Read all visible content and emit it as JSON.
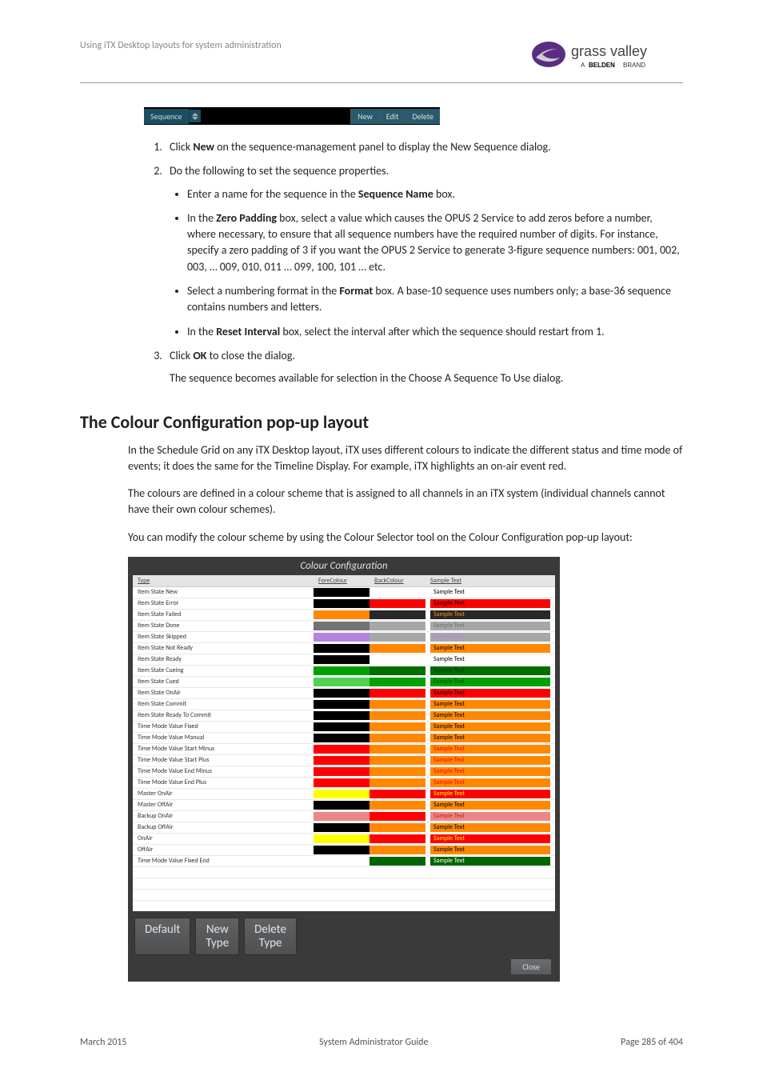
{
  "header": {
    "text": "Using iTX Desktop layouts for system administration",
    "brand_main": "grass valley",
    "brand_sub": "A BELDEN BRAND"
  },
  "sequence_bar": {
    "label": "Sequence",
    "btn_new": "New",
    "btn_edit": "Edit",
    "btn_delete": "Delete"
  },
  "steps": {
    "s1_pre": "Click ",
    "s1_bold": "New",
    "s1_post": " on the sequence-management panel to display the New Sequence dialog.",
    "s2": "Do the following to set the sequence properties.",
    "s2_b1_pre": "Enter a name for the sequence in the ",
    "s2_b1_bold": "Sequence Name",
    "s2_b1_post": " box.",
    "s2_b2_pre": "In the ",
    "s2_b2_bold": "Zero Padding",
    "s2_b2_post": " box, select a value which causes the OPUS 2 Service to add zeros before a number, where necessary, to ensure that all sequence numbers have the required number of digits. For instance, specify a zero padding of 3 if you want the OPUS 2 Service to generate 3-figure sequence numbers: 001, 002, 003, … 009, 010, 011 … 099, 100, 101 … etc.",
    "s2_b3_pre": "Select a numbering format in the ",
    "s2_b3_bold": "Format",
    "s2_b3_post": " box. A base-10 sequence uses numbers only; a base-36 sequence contains numbers and letters.",
    "s2_b4_pre": "In the ",
    "s2_b4_bold": "Reset Interval",
    "s2_b4_post": " box, select the interval after which the sequence should restart from 1.",
    "s3_pre": "Click ",
    "s3_bold": "OK",
    "s3_post": " to close the dialog.",
    "s3_after": "The sequence becomes available for selection in the Choose A Sequence To Use dialog."
  },
  "section_title": "The Colour Configuration pop-up layout",
  "paras": {
    "p1": "In the Schedule Grid on any iTX Desktop layout, iTX uses different colours to indicate the different status and time mode of events; it does the same for the Timeline Display. For example, iTX highlights an on-air event red.",
    "p2": "The colours are defined in a colour scheme that is assigned to all channels in an iTX system (individual channels cannot have their own colour schemes).",
    "p3": "You can modify the colour scheme by using the Colour Selector tool on the Colour Configuration pop-up layout:"
  },
  "cc": {
    "title": "Colour Configuration",
    "col_type": "Type",
    "col_front": "ForeColour",
    "col_back": "BackColour",
    "col_sample": "Sample Text",
    "rows": [
      {
        "type": "Item State New",
        "front": "#000000",
        "back": "#ffffff",
        "sample": "Sample Text",
        "sf": "#000000",
        "sb": "#ffffff"
      },
      {
        "type": "Item State Error",
        "front": "#000000",
        "back": "#ff0000",
        "sample": "Sample Text",
        "sf": "#000000",
        "sb": "#ff0000"
      },
      {
        "type": "Item State Failed",
        "front": "#ff8800",
        "back": "#282828",
        "sample": "Sample Text",
        "sf": "#ff8800",
        "sb": "#282828"
      },
      {
        "type": "Item State Done",
        "front": "#737373",
        "back": "#a7a7a7",
        "sample": "Sample Text",
        "sf": "#737373",
        "sb": "#a7a7a7"
      },
      {
        "type": "Item State Skipped",
        "front": "#b684de",
        "back": "#a7a7a7",
        "sample": "Sample Text",
        "sf": "#b684de",
        "sb": "#a7a7a7"
      },
      {
        "type": "Item State Not Ready",
        "front": "#000000",
        "back": "#ff8800",
        "sample": "Sample Text",
        "sf": "#000000",
        "sb": "#ff8800"
      },
      {
        "type": "Item State Ready",
        "front": "#000000",
        "back": "#ffffff",
        "sample": "Sample Text",
        "sf": "#000000",
        "sb": "#ffffff"
      },
      {
        "type": "Item State Cueing",
        "front": "#00a100",
        "back": "#006e00",
        "sample": "Sample Text",
        "sf": "#003800",
        "sb": "#006e00"
      },
      {
        "type": "Item State Cued",
        "front": "#52d252",
        "back": "#00a100",
        "sample": "Sample Text",
        "sf": "#0e4c0e",
        "sb": "#00a100"
      },
      {
        "type": "Item State OnAir",
        "front": "#000000",
        "back": "#ff0000",
        "sample": "Sample Text",
        "sf": "#000000",
        "sb": "#ff0000"
      },
      {
        "type": "Item State Commit",
        "front": "#000000",
        "back": "#ff8800",
        "sample": "Sample Text",
        "sf": "#000000",
        "sb": "#ff8800"
      },
      {
        "type": "Item State Ready To Commit",
        "front": "#000000",
        "back": "#ff8800",
        "sample": "Sample Text",
        "sf": "#000000",
        "sb": "#ff8800"
      },
      {
        "type": "Time Mode Value Fixed",
        "front": "#000000",
        "back": "#ff8800",
        "sample": "Sample Text",
        "sf": "#000000",
        "sb": "#ff8800"
      },
      {
        "type": "Time Mode Value Manual",
        "front": "#000000",
        "back": "#ff8800",
        "sample": "Sample Text",
        "sf": "#000000",
        "sb": "#ff8800"
      },
      {
        "type": "Time Mode Value Start Minus",
        "front": "#ff0000",
        "back": "#ff8800",
        "sample": "Sample Text",
        "sf": "#ff0000",
        "sb": "#ff8800"
      },
      {
        "type": "Time Mode Value Start Plus",
        "front": "#ff0000",
        "back": "#ff8800",
        "sample": "Sample Text",
        "sf": "#ff0000",
        "sb": "#ff8800"
      },
      {
        "type": "Time Mode Value End Minus",
        "front": "#ff0000",
        "back": "#ff8800",
        "sample": "Sample Text",
        "sf": "#ff0000",
        "sb": "#ff8800"
      },
      {
        "type": "Time Mode Value End Plus",
        "front": "#ff0000",
        "back": "#ff8800",
        "sample": "Sample Text",
        "sf": "#ff0000",
        "sb": "#ff8800"
      },
      {
        "type": "Master OnAir",
        "front": "#ffff00",
        "back": "#ff0000",
        "sample": "Sample Text",
        "sf": "#ffff00",
        "sb": "#ff0000"
      },
      {
        "type": "Master OffAir",
        "front": "#000000",
        "back": "#ff8800",
        "sample": "Sample Text",
        "sf": "#000000",
        "sb": "#ff8800"
      },
      {
        "type": "Backup OnAir",
        "front": "#ed8787",
        "back": "#ff0000",
        "sample": "Sample Text",
        "sf": "#cf1818",
        "sb": "#ed8787"
      },
      {
        "type": "Backup OffAir",
        "front": "#000000",
        "back": "#ff8800",
        "sample": "Sample Text",
        "sf": "#000000",
        "sb": "#ff8800"
      },
      {
        "type": "OnAir",
        "front": "#ffff00",
        "back": "#ff0000",
        "sample": "Sample Text",
        "sf": "#ffff00",
        "sb": "#ff0000"
      },
      {
        "type": "OffAir",
        "front": "#000000",
        "back": "#ff8800",
        "sample": "Sample Text",
        "sf": "#000000",
        "sb": "#ff8800"
      },
      {
        "type": "Time Mode Value Fixed End",
        "front": "#ffffff",
        "back": "#006400",
        "sample": "Sample Text",
        "sf": "#ffffff",
        "sb": "#006400"
      }
    ],
    "btn_default": "Default",
    "btn_newtype_l1": "New",
    "btn_newtype_l2": "Type",
    "btn_deltype_l1": "Delete",
    "btn_deltype_l2": "Type",
    "btn_close": "Close"
  },
  "footer": {
    "left": "March 2015",
    "center": "System Administrator Guide",
    "right": "Page 285 of 404"
  }
}
